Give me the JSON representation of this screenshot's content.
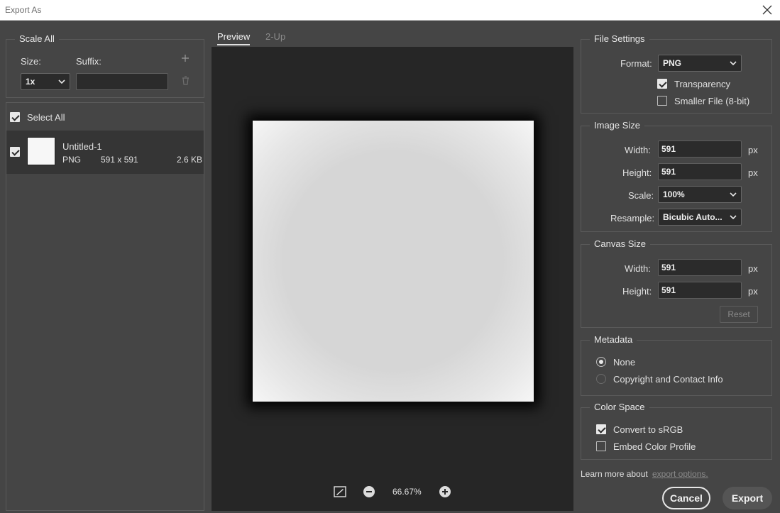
{
  "window": {
    "title": "Export As"
  },
  "scale_all": {
    "legend": "Scale All",
    "size_label": "Size:",
    "suffix_label": "Suffix:",
    "size_value": "1x",
    "suffix_value": ""
  },
  "file_list": {
    "select_all_label": "Select All",
    "items": [
      {
        "name": "Untitled-1",
        "format": "PNG",
        "dimensions": "591 x 591",
        "size": "2.6 KB"
      }
    ]
  },
  "preview": {
    "tabs": [
      "Preview",
      "2-Up"
    ],
    "zoom": "66.67%"
  },
  "file_settings": {
    "legend": "File Settings",
    "format_label": "Format:",
    "format_value": "PNG",
    "transparency_label": "Transparency",
    "transparency_checked": true,
    "smaller_file_label": "Smaller File (8-bit)",
    "smaller_file_checked": false
  },
  "image_size": {
    "legend": "Image Size",
    "width_label": "Width:",
    "width_value": "591",
    "height_label": "Height:",
    "height_value": "591",
    "unit": "px",
    "scale_label": "Scale:",
    "scale_value": "100%",
    "resample_label": "Resample:",
    "resample_value": "Bicubic Auto..."
  },
  "canvas_size": {
    "legend": "Canvas Size",
    "width_label": "Width:",
    "width_value": "591",
    "height_label": "Height:",
    "height_value": "591",
    "unit": "px",
    "reset_label": "Reset"
  },
  "metadata": {
    "legend": "Metadata",
    "options": [
      "None",
      "Copyright and Contact Info"
    ],
    "selected": "None"
  },
  "color_space": {
    "legend": "Color Space",
    "convert_label": "Convert to sRGB",
    "convert_checked": true,
    "embed_label": "Embed Color Profile",
    "embed_checked": false
  },
  "footer": {
    "learn_more_text": "Learn more about",
    "learn_more_link": "export options.",
    "cancel_label": "Cancel",
    "export_label": "Export"
  },
  "colors": {
    "dialog_bg": "#454545",
    "canvas_bg": "#262626",
    "selected_row": "#353535"
  }
}
